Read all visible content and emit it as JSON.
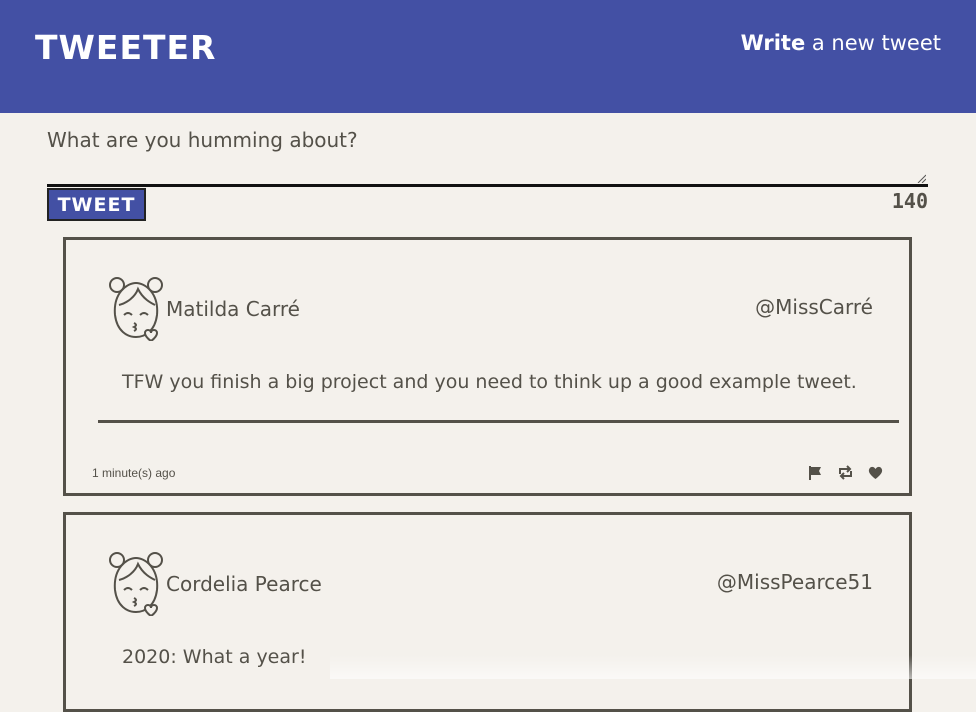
{
  "header": {
    "brand": "TWEETER",
    "write_bold": "Write",
    "write_rest": " a new tweet"
  },
  "composer": {
    "placeholder": "What are you humming about?",
    "button_label": "TWEET",
    "counter": "140"
  },
  "tweets": [
    {
      "name": "Matilda Carré",
      "handle": "@MissCarré",
      "body": "TFW you finish a big project and you need to think up a good example tweet.",
      "timestamp": "1 minute(s) ago"
    },
    {
      "name": "Cordelia Pearce",
      "handle": "@MissPearce51",
      "body": "2020: What a year!"
    }
  ],
  "icons": [
    "flag-icon",
    "retweet-icon",
    "heart-icon",
    "avatar-icon"
  ]
}
